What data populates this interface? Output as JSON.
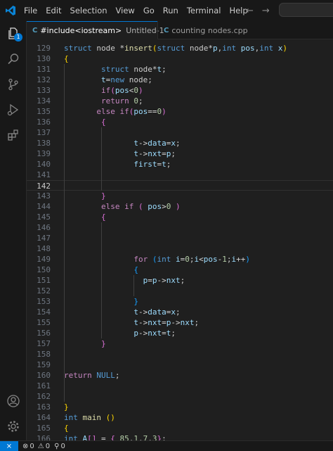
{
  "menu": [
    "File",
    "Edit",
    "Selection",
    "View",
    "Go",
    "Run",
    "Terminal",
    "Help"
  ],
  "nav": {
    "back": "←",
    "forward": "→"
  },
  "tabs": [
    {
      "label": "#include<iostream>",
      "sublabel": "Untitled-1",
      "modified": true,
      "active": true,
      "icon": "C"
    },
    {
      "label": "counting nodes.cpp",
      "active": false,
      "icon": "C"
    }
  ],
  "activity": {
    "explorer_badge": "1"
  },
  "status": {
    "errors": "0",
    "warnings": "0",
    "ports": "0",
    "remote": "⨯"
  },
  "colors": {
    "accent": "#0078d4",
    "keyword": "#569cd6",
    "control": "#c586c0",
    "function": "#dcdcaa",
    "variable": "#9cdcfe",
    "number": "#b5cea8"
  },
  "editor": {
    "active_line": "142",
    "lines": [
      {
        "n": "129",
        "tokens": [
          [
            "kw",
            "struct"
          ],
          [
            "t",
            " node "
          ],
          [
            "op",
            "*"
          ],
          [
            "fn",
            "insert"
          ],
          [
            "b1",
            "("
          ],
          [
            "kw",
            "struct"
          ],
          [
            "t",
            " node"
          ],
          [
            "op",
            "*"
          ],
          [
            "id",
            "p"
          ],
          [
            "t",
            ","
          ],
          [
            "kw",
            "int"
          ],
          [
            "t",
            " "
          ],
          [
            "id",
            "pos"
          ],
          [
            "t",
            ","
          ],
          [
            "kw",
            "int"
          ],
          [
            "t",
            " "
          ],
          [
            "id",
            "x"
          ],
          [
            "b1",
            ")"
          ]
        ]
      },
      {
        "n": "130",
        "tokens": [
          [
            "b1",
            "{"
          ]
        ]
      },
      {
        "n": "131",
        "tokens": [
          [
            "t",
            "        "
          ],
          [
            "kw",
            "struct"
          ],
          [
            "t",
            " node"
          ],
          [
            "op",
            "*"
          ],
          [
            "id",
            "t"
          ],
          [
            "t",
            ";"
          ]
        ]
      },
      {
        "n": "132",
        "tokens": [
          [
            "t",
            "        "
          ],
          [
            "id",
            "t"
          ],
          [
            "op",
            "="
          ],
          [
            "kw",
            "new"
          ],
          [
            "t",
            " node;"
          ]
        ]
      },
      {
        "n": "133",
        "tokens": [
          [
            "t",
            "        "
          ],
          [
            "ctl",
            "if"
          ],
          [
            "b2",
            "("
          ],
          [
            "id",
            "pos"
          ],
          [
            "op",
            "<"
          ],
          [
            "num",
            "0"
          ],
          [
            "b2",
            ")"
          ]
        ]
      },
      {
        "n": "134",
        "tokens": [
          [
            "t",
            "        "
          ],
          [
            "ctl",
            "return"
          ],
          [
            "t",
            " "
          ],
          [
            "num",
            "0"
          ],
          [
            "t",
            ";"
          ]
        ]
      },
      {
        "n": "135",
        "tokens": [
          [
            "t",
            "       "
          ],
          [
            "ctl",
            "else"
          ],
          [
            "t",
            " "
          ],
          [
            "ctl",
            "if"
          ],
          [
            "b2",
            "("
          ],
          [
            "id",
            "pos"
          ],
          [
            "op",
            "=="
          ],
          [
            "num",
            "0"
          ],
          [
            "b2",
            ")"
          ]
        ]
      },
      {
        "n": "136",
        "tokens": [
          [
            "t",
            "        "
          ],
          [
            "b2",
            "{"
          ]
        ]
      },
      {
        "n": "137",
        "tokens": []
      },
      {
        "n": "138",
        "tokens": [
          [
            "t",
            "               "
          ],
          [
            "id",
            "t"
          ],
          [
            "op",
            "->"
          ],
          [
            "id",
            "data"
          ],
          [
            "op",
            "="
          ],
          [
            "id",
            "x"
          ],
          [
            "t",
            ";"
          ]
        ]
      },
      {
        "n": "139",
        "tokens": [
          [
            "t",
            "               "
          ],
          [
            "id",
            "t"
          ],
          [
            "op",
            "->"
          ],
          [
            "id",
            "nxt"
          ],
          [
            "op",
            "="
          ],
          [
            "id",
            "p"
          ],
          [
            "t",
            ";"
          ]
        ]
      },
      {
        "n": "140",
        "tokens": [
          [
            "t",
            "               "
          ],
          [
            "id",
            "first"
          ],
          [
            "op",
            "="
          ],
          [
            "id",
            "t"
          ],
          [
            "t",
            ";"
          ]
        ]
      },
      {
        "n": "141",
        "tokens": []
      },
      {
        "n": "142",
        "tokens": []
      },
      {
        "n": "143",
        "tokens": [
          [
            "t",
            "        "
          ],
          [
            "b2",
            "}"
          ]
        ]
      },
      {
        "n": "144",
        "tokens": [
          [
            "t",
            "        "
          ],
          [
            "ctl",
            "else"
          ],
          [
            "t",
            " "
          ],
          [
            "ctl",
            "if"
          ],
          [
            "t",
            " "
          ],
          [
            "b2",
            "("
          ],
          [
            "t",
            " "
          ],
          [
            "id",
            "pos"
          ],
          [
            "op",
            ">"
          ],
          [
            "num",
            "0"
          ],
          [
            "t",
            " "
          ],
          [
            "b2",
            ")"
          ]
        ]
      },
      {
        "n": "145",
        "tokens": [
          [
            "t",
            "        "
          ],
          [
            "b2",
            "{"
          ]
        ]
      },
      {
        "n": "146",
        "tokens": []
      },
      {
        "n": "147",
        "tokens": []
      },
      {
        "n": "148",
        "tokens": []
      },
      {
        "n": "149",
        "tokens": [
          [
            "t",
            "               "
          ],
          [
            "ctl",
            "for"
          ],
          [
            "t",
            " "
          ],
          [
            "b3",
            "("
          ],
          [
            "kw",
            "int"
          ],
          [
            "t",
            " "
          ],
          [
            "id",
            "i"
          ],
          [
            "op",
            "="
          ],
          [
            "num",
            "0"
          ],
          [
            "t",
            ";"
          ],
          [
            "id",
            "i"
          ],
          [
            "op",
            "<"
          ],
          [
            "id",
            "pos"
          ],
          [
            "op",
            "-"
          ],
          [
            "num",
            "1"
          ],
          [
            "t",
            ";"
          ],
          [
            "id",
            "i"
          ],
          [
            "op",
            "++"
          ],
          [
            "b3",
            ")"
          ]
        ]
      },
      {
        "n": "150",
        "tokens": [
          [
            "t",
            "               "
          ],
          [
            "b3",
            "{"
          ]
        ]
      },
      {
        "n": "151",
        "tokens": [
          [
            "t",
            "                 "
          ],
          [
            "id",
            "p"
          ],
          [
            "op",
            "="
          ],
          [
            "id",
            "p"
          ],
          [
            "op",
            "->"
          ],
          [
            "id",
            "nxt"
          ],
          [
            "t",
            ";"
          ]
        ]
      },
      {
        "n": "152",
        "tokens": []
      },
      {
        "n": "153",
        "tokens": [
          [
            "t",
            "               "
          ],
          [
            "b3",
            "}"
          ]
        ]
      },
      {
        "n": "154",
        "tokens": [
          [
            "t",
            "               "
          ],
          [
            "id",
            "t"
          ],
          [
            "op",
            "->"
          ],
          [
            "id",
            "data"
          ],
          [
            "op",
            "="
          ],
          [
            "id",
            "x"
          ],
          [
            "t",
            ";"
          ]
        ]
      },
      {
        "n": "155",
        "tokens": [
          [
            "t",
            "               "
          ],
          [
            "id",
            "t"
          ],
          [
            "op",
            "->"
          ],
          [
            "id",
            "nxt"
          ],
          [
            "op",
            "="
          ],
          [
            "id",
            "p"
          ],
          [
            "op",
            "->"
          ],
          [
            "id",
            "nxt"
          ],
          [
            "t",
            ";"
          ]
        ]
      },
      {
        "n": "156",
        "tokens": [
          [
            "t",
            "               "
          ],
          [
            "id",
            "p"
          ],
          [
            "op",
            "->"
          ],
          [
            "id",
            "nxt"
          ],
          [
            "op",
            "="
          ],
          [
            "id",
            "t"
          ],
          [
            "t",
            ";"
          ]
        ]
      },
      {
        "n": "157",
        "tokens": [
          [
            "t",
            "        "
          ],
          [
            "b2",
            "}"
          ]
        ]
      },
      {
        "n": "158",
        "tokens": []
      },
      {
        "n": "159",
        "tokens": []
      },
      {
        "n": "160",
        "tokens": [
          [
            "ctl",
            "return"
          ],
          [
            "t",
            " "
          ],
          [
            "kw",
            "NULL"
          ],
          [
            "t",
            ";"
          ]
        ]
      },
      {
        "n": "161",
        "tokens": []
      },
      {
        "n": "162",
        "tokens": []
      },
      {
        "n": "163",
        "tokens": [
          [
            "b1",
            "}"
          ]
        ]
      },
      {
        "n": "164",
        "tokens": [
          [
            "kw",
            "int"
          ],
          [
            "t",
            " "
          ],
          [
            "fn",
            "main"
          ],
          [
            "t",
            " "
          ],
          [
            "b1",
            "()"
          ]
        ]
      },
      {
        "n": "165",
        "tokens": [
          [
            "b1",
            "{"
          ]
        ]
      },
      {
        "n": "166",
        "tokens": [
          [
            "kw",
            "int"
          ],
          [
            "t",
            " "
          ],
          [
            "id",
            "A"
          ],
          [
            "b2",
            "[]"
          ],
          [
            "t",
            " "
          ],
          [
            "op",
            "="
          ],
          [
            "t",
            " "
          ],
          [
            "b2",
            "{"
          ],
          [
            "t",
            " "
          ],
          [
            "num",
            "85"
          ],
          [
            "t",
            ","
          ],
          [
            "num",
            "1"
          ],
          [
            "t",
            ","
          ],
          [
            "num",
            "7"
          ],
          [
            "t",
            ","
          ],
          [
            "num",
            "3"
          ],
          [
            "b2",
            "}"
          ],
          [
            "t",
            ";"
          ]
        ]
      }
    ]
  }
}
